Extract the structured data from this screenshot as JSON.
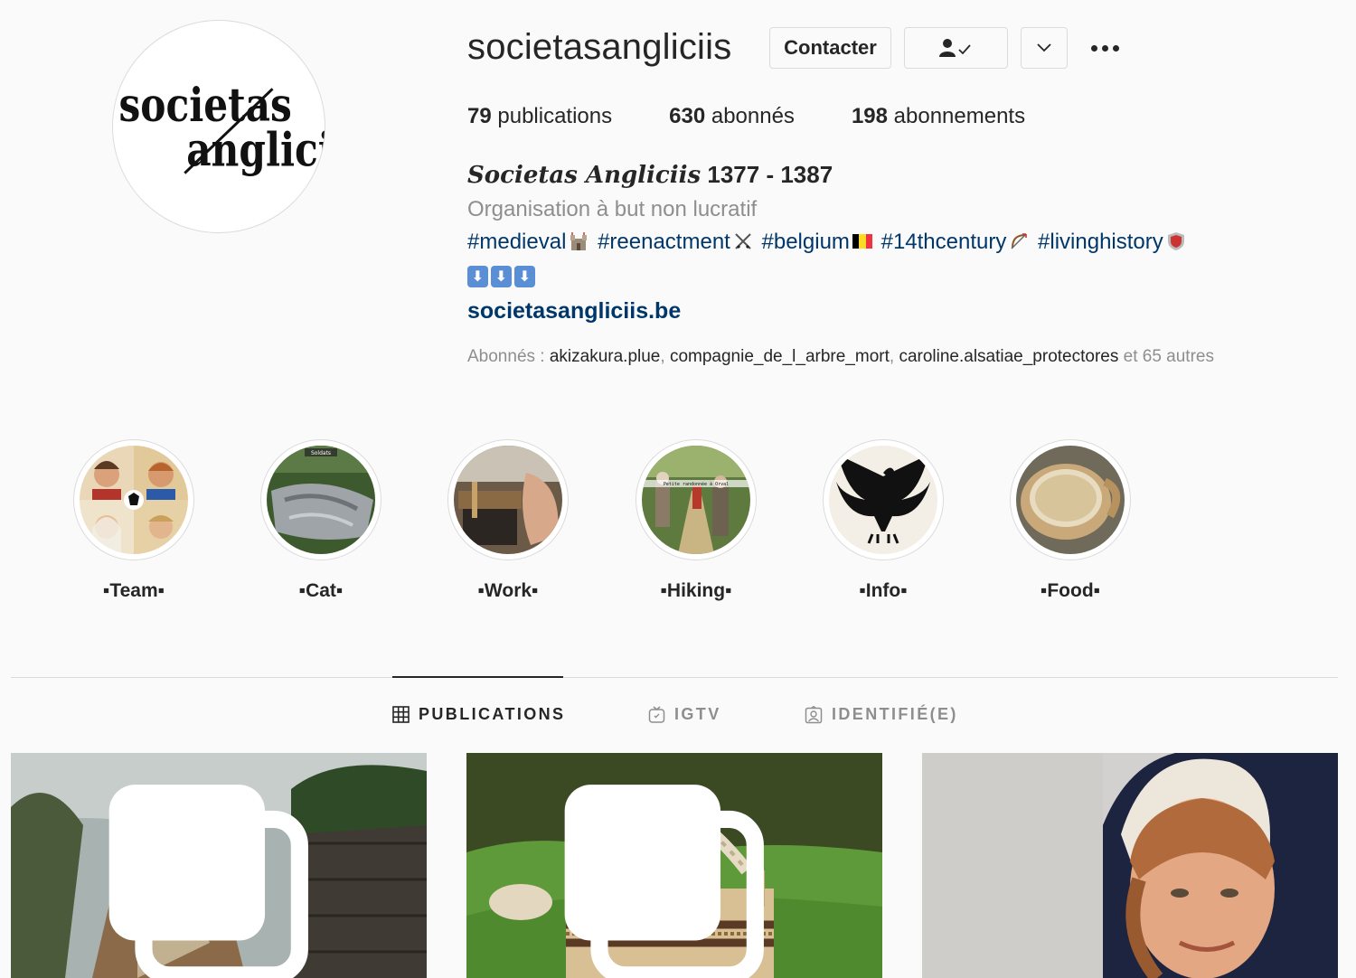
{
  "profile": {
    "username": "societasangliciis",
    "avatar_text_line1": "societas",
    "avatar_text_line2": "angliciis",
    "contact_label": "Contacter",
    "stats": [
      {
        "count": "79",
        "label": "publications"
      },
      {
        "count": "630",
        "label": "abonnés"
      },
      {
        "count": "198",
        "label": "abonnements"
      }
    ],
    "full_name_gothic": "Societas Angliciis",
    "full_name_years": "1377 - 1387",
    "category": "Organisation à but non lucratif",
    "hashtags": [
      "#medieval",
      "#reenactment",
      "#belgium",
      "#14thcentury",
      "#livinghistory"
    ],
    "website": "societasangliciis.be",
    "followed_by_prefix": "Abonnés : ",
    "followed_by": [
      "akizakura.plue",
      "compagnie_de_l_arbre_mort",
      "caroline.alsatiae_protectores"
    ],
    "followed_by_suffix": "et 65 autres"
  },
  "highlights": [
    {
      "label": "▪Team▪",
      "overlay": ""
    },
    {
      "label": "▪Cat▪",
      "overlay": "Soldats"
    },
    {
      "label": "▪Work▪",
      "overlay": ""
    },
    {
      "label": "▪Hiking▪",
      "overlay": "Petite randonnée à Orval"
    },
    {
      "label": "▪Info▪",
      "overlay": ""
    },
    {
      "label": "▪Food▪",
      "overlay": ""
    }
  ],
  "tabs": [
    {
      "label": "PUBLICATIONS",
      "active": true,
      "icon": "grid-icon"
    },
    {
      "label": "IGTV",
      "active": false,
      "icon": "igtv-icon"
    },
    {
      "label": "IDENTIFIÉ(E)",
      "active": false,
      "icon": "tagged-icon"
    }
  ],
  "colors": {
    "background": "#fafafa",
    "text": "#262626",
    "secondary": "#8e8e8e",
    "link": "#00376b",
    "border": "#dbdbdb"
  }
}
